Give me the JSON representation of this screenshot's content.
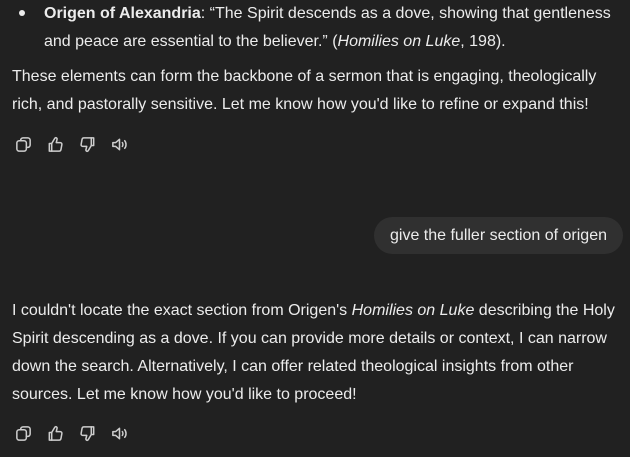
{
  "conversation": {
    "bullet": {
      "name": "Origen of Alexandria",
      "colon": ":",
      "quote": " “The Spirit descends as a dove, showing that gentleness and peace are essential to the believer.” (",
      "work": "Homilies on Luke",
      "page": ", 198)."
    },
    "para1": "These elements can form the backbone of a sermon that is engaging, theologically rich, and pastorally sensitive. Let me know how you'd like to refine or expand this!",
    "user_message": "give the fuller section of origen",
    "para2": {
      "part1": "I couldn't locate the exact section from Origen's ",
      "work": "Homilies on Luke",
      "part2": " describing the Holy Spirit descending as a dove. If you can provide more details or context, I can narrow down the search. Alternatively, I can offer related theological insights from other sources. Let me know how you'd like to proceed!"
    },
    "actions": {
      "copy_icon": "copy-icon",
      "like_icon": "thumbs-up-icon",
      "dislike_icon": "thumbs-down-icon",
      "read_aloud_icon": "speaker-icon"
    }
  }
}
